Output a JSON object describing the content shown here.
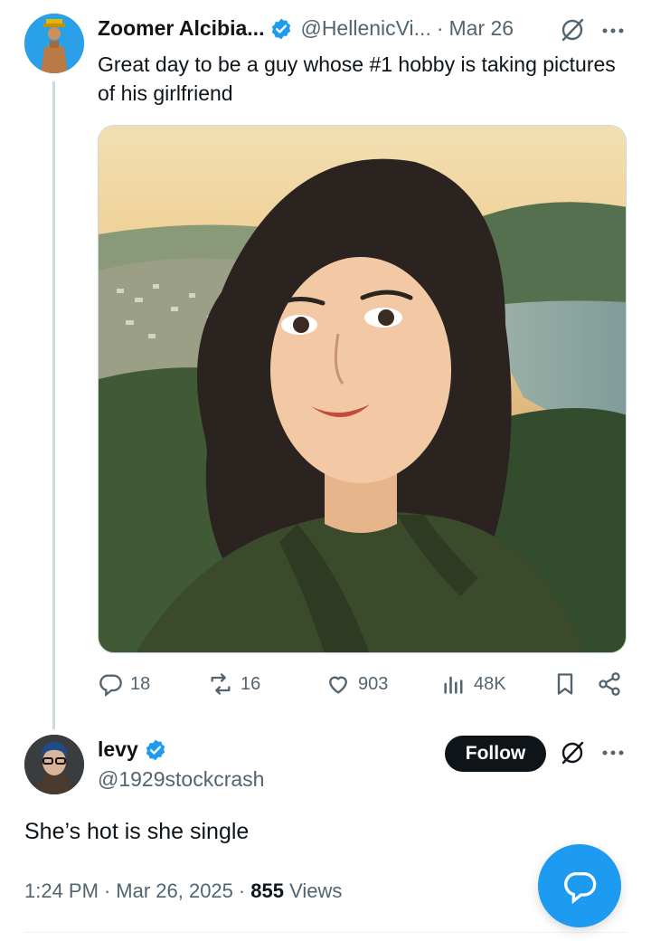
{
  "post": {
    "author_name": "Zoomer Alcibia...",
    "author_handle": "@HellenicVi...",
    "separator": "·",
    "date": "Mar 26",
    "text": "Great day to be a guy whose #1 hobby is taking pictures of his girlfriend",
    "stats": {
      "replies": "18",
      "reposts": "16",
      "likes": "903",
      "views": "48K"
    }
  },
  "reply": {
    "author_name": "levy",
    "author_handle": "@1929stockcrash",
    "follow_label": "Follow",
    "text": "She’s hot is she single",
    "time": "1:24 PM",
    "separator1": "·",
    "date": "Mar 26, 2025",
    "separator2": "·",
    "views_count": "855",
    "views_label": "Views"
  },
  "colors": {
    "accent": "#1d9bf0",
    "text": "#0f1419",
    "muted": "#536471",
    "follow_bg": "#0f1419"
  },
  "icons": {
    "verified": "verified-badge-icon",
    "grok": "grok-icon",
    "more": "more-icon",
    "reply": "reply-icon",
    "repost": "repost-icon",
    "like": "like-icon",
    "views": "views-icon",
    "bookmark": "bookmark-icon",
    "share": "share-icon",
    "compose": "reply-compose-icon"
  }
}
